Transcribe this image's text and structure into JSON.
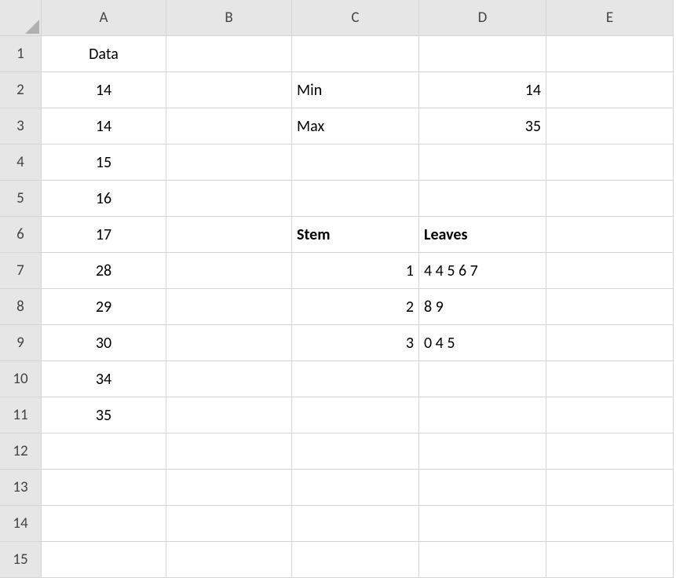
{
  "columns": [
    "A",
    "B",
    "C",
    "D",
    "E"
  ],
  "rowCount": 15,
  "cells": {
    "A1": {
      "value": "Data",
      "align": "center"
    },
    "A2": {
      "value": "14",
      "align": "center"
    },
    "A3": {
      "value": "14",
      "align": "center"
    },
    "A4": {
      "value": "15",
      "align": "center"
    },
    "A5": {
      "value": "16",
      "align": "center"
    },
    "A6": {
      "value": "17",
      "align": "center"
    },
    "A7": {
      "value": "28",
      "align": "center"
    },
    "A8": {
      "value": "29",
      "align": "center"
    },
    "A9": {
      "value": "30",
      "align": "center"
    },
    "A10": {
      "value": "34",
      "align": "center"
    },
    "A11": {
      "value": "35",
      "align": "center"
    },
    "C2": {
      "value": "Min",
      "align": "left"
    },
    "C3": {
      "value": "Max",
      "align": "left"
    },
    "D2": {
      "value": "14",
      "align": "right"
    },
    "D3": {
      "value": "35",
      "align": "right"
    },
    "C6": {
      "value": "Stem",
      "align": "left",
      "bold": true
    },
    "D6": {
      "value": "Leaves",
      "align": "left",
      "bold": true
    },
    "C7": {
      "value": "1",
      "align": "right"
    },
    "C8": {
      "value": "2",
      "align": "right"
    },
    "C9": {
      "value": "3",
      "align": "right"
    },
    "D7": {
      "value": " 4  4  5  6  7",
      "align": "left"
    },
    "D8": {
      "value": " 8  9",
      "align": "left"
    },
    "D9": {
      "value": " 0  4  5",
      "align": "left"
    }
  }
}
